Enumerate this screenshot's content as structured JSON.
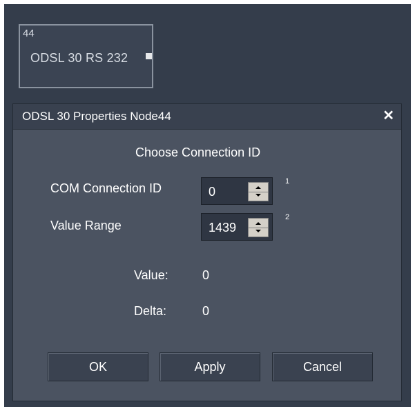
{
  "node": {
    "id": "44",
    "label": "ODSL 30 RS 232"
  },
  "dialog": {
    "title": "ODSL 30 Properties Node44",
    "close_glyph": "✕",
    "heading": "Choose Connection ID",
    "fields": [
      {
        "label": "COM Connection ID",
        "value": "0",
        "superscript": "1"
      },
      {
        "label": "Value Range",
        "value": "1439",
        "superscript": "2"
      }
    ],
    "readouts": [
      {
        "label": "Value:",
        "value": "0"
      },
      {
        "label": "Delta:",
        "value": "0"
      }
    ],
    "buttons": {
      "ok": "OK",
      "apply": "Apply",
      "cancel": "Cancel"
    }
  },
  "icons": [
    "close-icon",
    "spinner-up-icon",
    "spinner-down-icon",
    "node-port-icon"
  ],
  "colors": {
    "canvas": "#343d4b",
    "dialog": "#4b5361",
    "titlebar": "#39414f",
    "button": "#3a4250",
    "text": "#ffffff"
  }
}
